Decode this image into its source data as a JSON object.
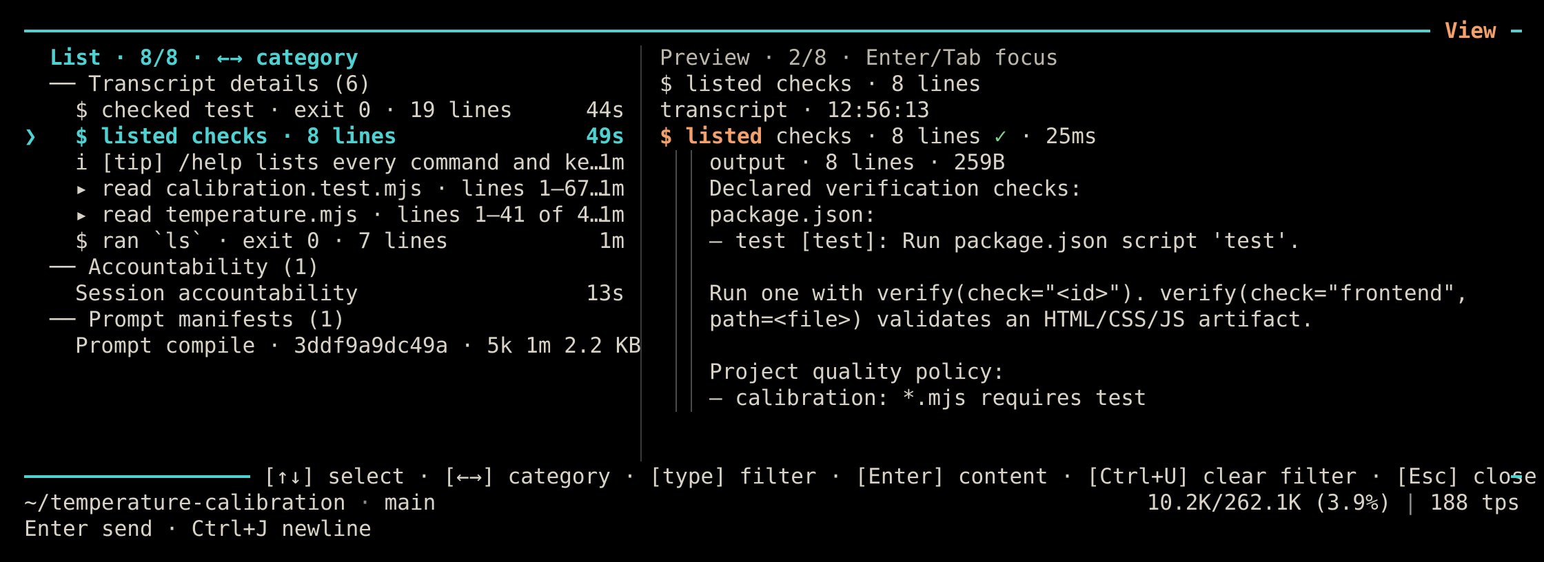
{
  "view_label": "View",
  "list_header": "List · 8/8 · ←→ category",
  "sections": [
    {
      "title": "── Transcript details (6)",
      "items": [
        {
          "text": "$ checked test · exit 0 · 19 lines",
          "time": "44s",
          "selected": false
        },
        {
          "text": "$ listed checks · 8 lines",
          "time": "49s",
          "selected": true,
          "marker": "❯"
        },
        {
          "text": "i [tip] /help lists every command and ke…",
          "time": "1m",
          "selected": false
        },
        {
          "text": "▸ read calibration.test.mjs · lines 1–67…",
          "time": "1m",
          "selected": false
        },
        {
          "text": "▸ read temperature.mjs · lines 1–41 of 4…",
          "time": "1m",
          "selected": false
        },
        {
          "text": "$ ran `ls` · exit 0 · 7 lines",
          "time": "1m",
          "selected": false
        }
      ]
    },
    {
      "title": "── Accountability (1)",
      "items": [
        {
          "text": "Session accountability",
          "time": "13s",
          "selected": false
        }
      ]
    },
    {
      "title": "── Prompt manifests (1)",
      "items": [
        {
          "text": "Prompt compile · 3ddf9a9dc49a · 5k 1m 2.2 KB",
          "time": "",
          "selected": false
        }
      ]
    }
  ],
  "preview": {
    "header": "Preview · 2/8 · Enter/Tab focus",
    "title": "$ listed checks · 8 lines",
    "meta": "transcript · 12:56:13",
    "cmd_prefix": "$ listed",
    "cmd_rest": " checks · 8 lines ",
    "check_mark": "✓",
    "duration": " · 25ms",
    "output_lines": [
      "output · 8 lines · 259B",
      "Declared verification checks:",
      "package.json:",
      "– test [test]: Run package.json script 'test'.",
      "",
      "Run one with verify(check=\"<id>\"). verify(check=\"frontend\",",
      "path=<file>) validates an HTML/CSS/JS artifact.",
      "",
      "Project quality policy:",
      "– calibration: *.mjs requires test"
    ]
  },
  "keybar": "[↑↓] select · [←→] category · [type] filter · [Enter] content · [Ctrl+U] clear filter · [Esc] close",
  "status": {
    "path": "~/temperature-calibration",
    "sep": " · ",
    "branch": "main",
    "tokens": "10.2K/262.1K (3.9%)",
    "pipe": " | ",
    "tps_value": "188",
    "tps_unit": " tps",
    "hint": "Enter send · Ctrl+J newline"
  },
  "colors": {
    "accent": "#4fd1d1",
    "orange": "#f4a06a",
    "green": "#7fd08a",
    "text": "#d9d3c7",
    "background": "#000000"
  }
}
